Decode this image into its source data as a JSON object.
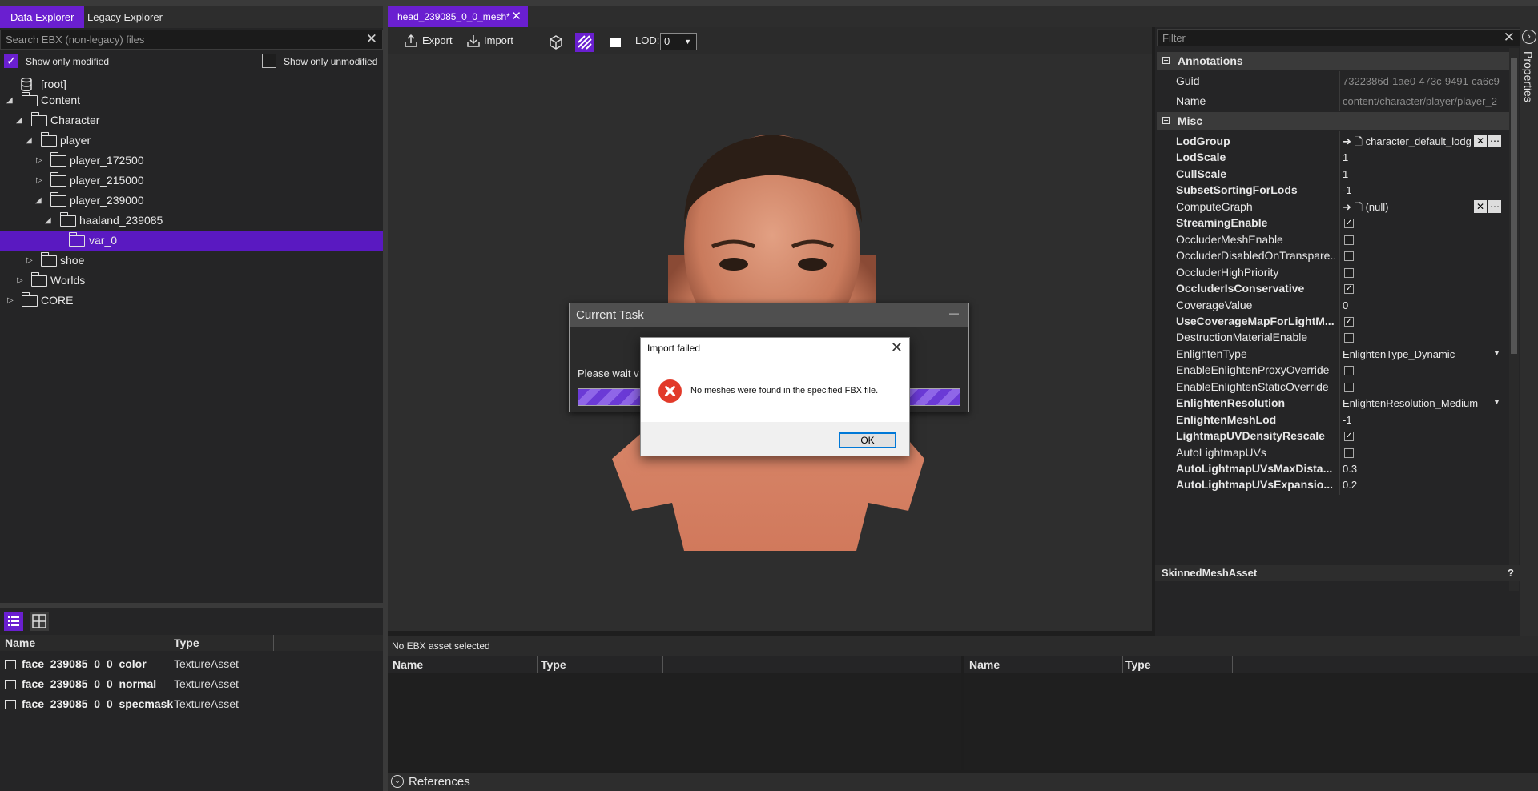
{
  "left": {
    "tabs": [
      "Data Explorer",
      "Legacy Explorer"
    ],
    "search_placeholder": "Search EBX (non-legacy) files",
    "show_only_modified": "Show only modified",
    "show_only_unmodified": "Show only unmodified",
    "tree": [
      {
        "label": "[root]",
        "level": 0
      },
      {
        "label": "Content",
        "level": 0
      },
      {
        "label": "Character",
        "level": 1
      },
      {
        "label": "player",
        "level": 2
      },
      {
        "label": "player_172500",
        "level": 3
      },
      {
        "label": "player_215000",
        "level": 3
      },
      {
        "label": "player_239000",
        "level": 3
      },
      {
        "label": "haaland_239085",
        "level": 4
      },
      {
        "label": "var_0",
        "level": 5
      },
      {
        "label": "shoe",
        "level": 2
      },
      {
        "label": "Worlds",
        "level": 1
      },
      {
        "label": "CORE",
        "level": 0
      }
    ],
    "list": {
      "columns": [
        "Name",
        "Type"
      ],
      "rows": [
        {
          "name": "face_239085_0_0_color",
          "type": "TextureAsset"
        },
        {
          "name": "face_239085_0_0_normal",
          "type": "TextureAsset"
        },
        {
          "name": "face_239085_0_0_specmask",
          "type": "TextureAsset"
        }
      ]
    }
  },
  "editor": {
    "tab_title": "head_239085_0_0_mesh*",
    "export_label": "Export",
    "import_label": "Import",
    "lod_label": "LOD:",
    "lod_value": "0"
  },
  "task_dialog": {
    "title": "Current Task",
    "text": "Please wait v",
    "minimize": "—"
  },
  "error_dialog": {
    "title": "Import failed",
    "message": "No meshes were found in the specified FBX file.",
    "ok": "OK"
  },
  "bottom": {
    "status": "No EBX asset selected",
    "columns": [
      "Name",
      "Type"
    ],
    "references": "References"
  },
  "properties": {
    "filter_placeholder": "Filter",
    "tab_label": "Properties",
    "sections": {
      "annotations": "Annotations",
      "misc": "Misc"
    },
    "annotations": [
      {
        "name": "Guid",
        "value": "7322386d-1ae0-473c-9491-ca6c9"
      },
      {
        "name": "Name",
        "value": "content/character/player/player_2"
      }
    ],
    "misc": [
      {
        "name": "LodGroup",
        "bold": true,
        "value": "character_default_lodg",
        "kind": "ref"
      },
      {
        "name": "LodScale",
        "bold": true,
        "value": "1"
      },
      {
        "name": "CullScale",
        "bold": true,
        "value": "1"
      },
      {
        "name": "SubsetSortingForLods",
        "bold": true,
        "value": "-1"
      },
      {
        "name": "ComputeGraph",
        "bold": false,
        "value": "(null)",
        "kind": "ref"
      },
      {
        "name": "StreamingEnable",
        "bold": true,
        "check": true
      },
      {
        "name": "OccluderMeshEnable",
        "bold": false,
        "check": false
      },
      {
        "name": "OccluderDisabledOnTranspare...",
        "bold": false,
        "check": false
      },
      {
        "name": "OccluderHighPriority",
        "bold": false,
        "check": false
      },
      {
        "name": "OccluderIsConservative",
        "bold": true,
        "check": true
      },
      {
        "name": "CoverageValue",
        "bold": false,
        "value": "0"
      },
      {
        "name": "UseCoverageMapForLightM...",
        "bold": true,
        "check": true
      },
      {
        "name": "DestructionMaterialEnable",
        "bold": false,
        "check": false
      },
      {
        "name": "EnlightenType",
        "bold": false,
        "value": "EnlightenType_Dynamic",
        "kind": "enum"
      },
      {
        "name": "EnableEnlightenProxyOverride",
        "bold": false,
        "check": false
      },
      {
        "name": "EnableEnlightenStaticOverride",
        "bold": false,
        "check": false
      },
      {
        "name": "EnlightenResolution",
        "bold": true,
        "value": "EnlightenResolution_Medium",
        "kind": "enum"
      },
      {
        "name": "EnlightenMeshLod",
        "bold": true,
        "value": "-1"
      },
      {
        "name": "LightmapUVDensityRescale",
        "bold": true,
        "check": true
      },
      {
        "name": "AutoLightmapUVs",
        "bold": false,
        "check": false
      },
      {
        "name": "AutoLightmapUVsMaxDista...",
        "bold": true,
        "value": "0.3"
      },
      {
        "name": "AutoLightmapUVsExpansio...",
        "bold": true,
        "value": "0.2"
      }
    ],
    "footer_type": "SkinnedMeshAsset",
    "footer_help": "?"
  },
  "colors": {
    "accent": "#6a1fd0",
    "selected_row": "#5a19c1",
    "background": "#1e1e1e"
  }
}
